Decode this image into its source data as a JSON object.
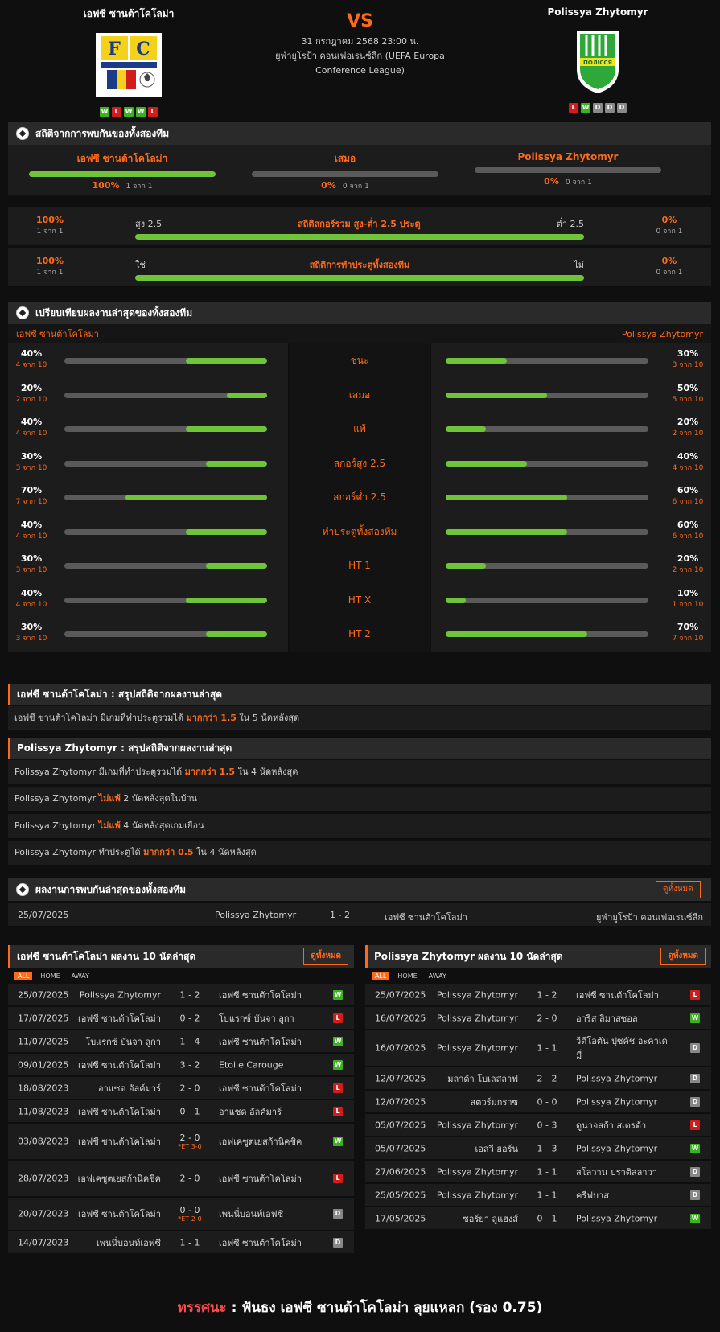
{
  "match": {
    "home": "เอฟซี ซานต้าโคโลม่า",
    "away": "Polissya Zhytomyr",
    "vs": "VS",
    "datetime": "31 กรกฎาคม 2568 23:00 น.",
    "competition": "ยูฟ่ายูโรป้า คอนเฟอเรนซ์ลีก (UEFA Europa Conference League)",
    "home_form": [
      "W",
      "L",
      "W",
      "W",
      "L"
    ],
    "away_form": [
      "L",
      "W",
      "D",
      "D",
      "D"
    ],
    "home_logo_text": "FC Sta. COLOMA",
    "away_logo_text": "ПОЛІССЯ"
  },
  "h2h_stats": {
    "title": "สถิติจากการพบกันของทั้งสองทีม",
    "cols": [
      {
        "label": "เอฟซี ซานต้าโคโลม่า",
        "pct": "100%",
        "count": "1 จาก 1",
        "fill": 1.0
      },
      {
        "label": "เสมอ",
        "pct": "0%",
        "count": "0 จาก 1",
        "fill": 0
      },
      {
        "label": "Polissya Zhytomyr",
        "pct": "0%",
        "count": "0 จาก 1",
        "fill": 0
      }
    ],
    "ou": {
      "title": "สถิติสกอร์รวม สูง-ต่ำ 2.5 ประตู",
      "left_label": "สูง 2.5",
      "right_label": "ต่ำ 2.5",
      "left_pct": "100%",
      "left_count": "1 จาก 1",
      "right_pct": "0%",
      "right_count": "0 จาก 1",
      "fill": 1.0
    },
    "btts": {
      "title": "สถิติการทำประตูทั้งสองทีม",
      "left_label": "ใช่",
      "right_label": "ไม่",
      "left_pct": "100%",
      "left_count": "1 จาก 1",
      "right_pct": "0%",
      "right_count": "0 จาก 1",
      "fill": 1.0
    }
  },
  "comparison": {
    "title": "เปรียบเทียบผลงานล่าสุดของทั้งสองทีม",
    "home": "เอฟซี ซานต้าโคโลม่า",
    "away": "Polissya Zhytomyr",
    "rows": [
      {
        "label": "ชนะ",
        "lp": "40%",
        "lc": "4 จาก 10",
        "lf": 0.4,
        "rp": "30%",
        "rc": "3 จาก 10",
        "rf": 0.3
      },
      {
        "label": "เสมอ",
        "lp": "20%",
        "lc": "2 จาก 10",
        "lf": 0.2,
        "rp": "50%",
        "rc": "5 จาก 10",
        "rf": 0.5
      },
      {
        "label": "แพ้",
        "lp": "40%",
        "lc": "4 จาก 10",
        "lf": 0.4,
        "rp": "20%",
        "rc": "2 จาก 10",
        "rf": 0.2
      },
      {
        "label": "สกอร์สูง 2.5",
        "lp": "30%",
        "lc": "3 จาก 10",
        "lf": 0.3,
        "rp": "40%",
        "rc": "4 จาก 10",
        "rf": 0.4
      },
      {
        "label": "สกอร์ต่ำ 2.5",
        "lp": "70%",
        "lc": "7 จาก 10",
        "lf": 0.7,
        "rp": "60%",
        "rc": "6 จาก 10",
        "rf": 0.6
      },
      {
        "label": "ทำประตูทั้งสองทีม",
        "lp": "40%",
        "lc": "4 จาก 10",
        "lf": 0.4,
        "rp": "60%",
        "rc": "6 จาก 10",
        "rf": 0.6
      },
      {
        "label": "HT 1",
        "lp": "30%",
        "lc": "3 จาก 10",
        "lf": 0.3,
        "rp": "20%",
        "rc": "2 จาก 10",
        "rf": 0.2
      },
      {
        "label": "HT X",
        "lp": "40%",
        "lc": "4 จาก 10",
        "lf": 0.4,
        "rp": "10%",
        "rc": "1 จาก 10",
        "rf": 0.1
      },
      {
        "label": "HT 2",
        "lp": "30%",
        "lc": "3 จาก 10",
        "lf": 0.3,
        "rp": "70%",
        "rc": "7 จาก 10",
        "rf": 0.7
      }
    ]
  },
  "summary": {
    "home_head": "เอฟซี ซานต้าโคโลม่า : สรุปสถิติจากผลงานล่าสุด",
    "home_rows": [
      {
        "a": "เอฟซี ซานต้าโคโลม่า  มีเกมที่ทำประตูรวมได้ ",
        "b": "มากกว่า 1.5",
        "c": " ใน 5 นัดหลังสุด"
      }
    ],
    "away_head": "Polissya Zhytomyr : สรุปสถิติจากผลงานล่าสุด",
    "away_rows": [
      {
        "a": "Polissya Zhytomyr  มีเกมที่ทำประตูรวมได้ ",
        "b": "มากกว่า 1.5",
        "c": " ใน 4 นัดหลังสุด"
      },
      {
        "a": "Polissya Zhytomyr ",
        "b": "ไม่แพ้",
        "c": " 2 นัดหลังสุดในบ้าน"
      },
      {
        "a": "Polissya Zhytomyr ",
        "b": "ไม่แพ้",
        "c": " 4 นัดหลังสุดเกมเยือน"
      },
      {
        "a": "Polissya Zhytomyr  ทำประตูได้ ",
        "b": "มากกว่า 0.5",
        "c": " ใน 4 นัดหลังสุด"
      }
    ]
  },
  "recent_h2h": {
    "title": "ผลงานการพบกันล่าสุดของทั้งสองทีม",
    "see_all": "ดูทั้งหมด",
    "date": "25/07/2025",
    "home": "Polissya Zhytomyr",
    "score": "1 - 2",
    "away": "เอฟซี ซานต้าโคโลม่า",
    "league": "ยูฟ่ายูโรป้า คอนเฟอเรนซ์ลีก"
  },
  "tabs": [
    "ALL",
    "HOME",
    "AWAY"
  ],
  "home_last10": {
    "title": "เอฟซี ซานต้าโคโลม่า ผลงาน 10 นัดล่าสุด",
    "see_all": "ดูทั้งหมด",
    "matches": [
      {
        "d": "25/07/2025",
        "h": "Polissya Zhytomyr",
        "s": "1 - 2",
        "x": "",
        "a": "เอฟซี ซานต้าโคโลม่า",
        "r": "W"
      },
      {
        "d": "17/07/2025",
        "h": "เอฟซี ซานต้าโคโลม่า",
        "s": "0 - 2",
        "x": "",
        "a": "โบแรกซ์ บันจา ลูกา",
        "r": "L"
      },
      {
        "d": "11/07/2025",
        "h": "โบแรกซ์ บันจา ลูกา",
        "s": "1 - 4",
        "x": "",
        "a": "เอฟซี ซานต้าโคโลม่า",
        "r": "W"
      },
      {
        "d": "09/01/2025",
        "h": "เอฟซี ซานต้าโคโลม่า",
        "s": "3 - 2",
        "x": "",
        "a": "Etoile Carouge",
        "r": "W"
      },
      {
        "d": "18/08/2023",
        "h": "อาแซด อัลค์มาร์",
        "s": "2 - 0",
        "x": "",
        "a": "เอฟซี ซานต้าโคโลม่า",
        "r": "L"
      },
      {
        "d": "11/08/2023",
        "h": "เอฟซี ซานต้าโคโลม่า",
        "s": "0 - 1",
        "x": "",
        "a": "อาแซด อัลค์มาร์",
        "r": "L"
      },
      {
        "d": "03/08/2023",
        "h": "เอฟซี ซานต้าโคโลม่า",
        "s": "2 - 0",
        "x": "*ET 3-0",
        "a": "เอฟเคซูตเยสก้านิคชิค",
        "r": "W"
      },
      {
        "d": "28/07/2023",
        "h": "เอฟเคซูตเยสก้านิคชิค",
        "s": "2 - 0",
        "x": "",
        "a": "เอฟซี ซานต้าโคโลม่า",
        "r": "L"
      },
      {
        "d": "20/07/2023",
        "h": "เอฟซี ซานต้าโคโลม่า",
        "s": "0 - 0",
        "x": "*ET 2-0",
        "a": "เพนนี่บอนท์เอฟซี",
        "r": "D"
      },
      {
        "d": "14/07/2023",
        "h": "เพนนี่บอนท์เอฟซี",
        "s": "1 - 1",
        "x": "",
        "a": "เอฟซี ซานต้าโคโลม่า",
        "r": "D"
      }
    ]
  },
  "away_last10": {
    "title": "Polissya Zhytomyr ผลงาน 10 นัดล่าสุด",
    "see_all": "ดูทั้งหมด",
    "matches": [
      {
        "d": "25/07/2025",
        "h": "Polissya Zhytomyr",
        "s": "1 - 2",
        "x": "",
        "a": "เอฟซี ซานต้าโคโลม่า",
        "r": "L"
      },
      {
        "d": "16/07/2025",
        "h": "Polissya Zhytomyr",
        "s": "2 - 0",
        "x": "",
        "a": "อาริส ลิมาสซอล",
        "r": "W"
      },
      {
        "d": "16/07/2025",
        "h": "Polissya Zhytomyr",
        "s": "1 - 1",
        "x": "",
        "a": "วีดีโอตัน ปุซคัช อะคาเดมี่",
        "r": "D"
      },
      {
        "d": "12/07/2025",
        "h": "มลาด้า โบเลสลาฟ",
        "s": "2 - 2",
        "x": "",
        "a": "Polissya Zhytomyr",
        "r": "D"
      },
      {
        "d": "12/07/2025",
        "h": "สตวร์มกราซ",
        "s": "0 - 0",
        "x": "",
        "a": "Polissya Zhytomyr",
        "r": "D"
      },
      {
        "d": "05/07/2025",
        "h": "Polissya Zhytomyr",
        "s": "0 - 3",
        "x": "",
        "a": "ดูนาจสก้า สเตรด้า",
        "r": "L"
      },
      {
        "d": "05/07/2025",
        "h": "เอสวี ฮอร์น",
        "s": "1 - 3",
        "x": "",
        "a": "Polissya Zhytomyr",
        "r": "W"
      },
      {
        "d": "27/06/2025",
        "h": "Polissya Zhytomyr",
        "s": "1 - 1",
        "x": "",
        "a": "สโลวาน บราติสลาวา",
        "r": "D"
      },
      {
        "d": "25/05/2025",
        "h": "Polissya Zhytomyr",
        "s": "1 - 1",
        "x": "",
        "a": "ครีฟบาส",
        "r": "D"
      },
      {
        "d": "17/05/2025",
        "h": "ซอร์ย่า ลูแฮงส์",
        "s": "0 - 1",
        "x": "",
        "a": "Polissya Zhytomyr",
        "r": "W"
      }
    ]
  },
  "verdict": {
    "label": "ทรรศนะ",
    "colon": " :  ",
    "text": "ฟันธง เอฟซี ซานต้าโคโลม่า ลุยแหลก (รอง 0.75)"
  },
  "colors": {
    "accent": "#ff6a1a",
    "bar_fill": "#6fc43a",
    "win": "#3bb31f",
    "loss": "#d11c1c",
    "draw": "#888888"
  }
}
